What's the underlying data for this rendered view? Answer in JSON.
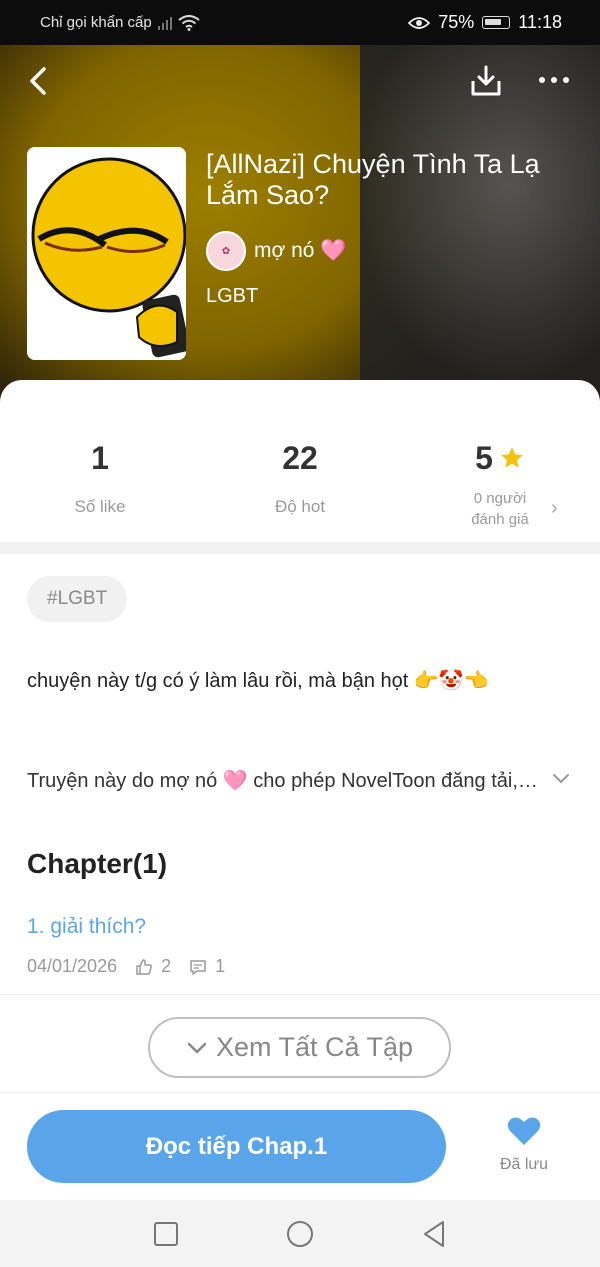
{
  "status_bar": {
    "carrier": "Chỉ gọi khẩn cấp",
    "battery": "75%",
    "time": "11:18"
  },
  "header": {
    "title": "[AllNazi] Chuyện Tình Ta Lạ Lắm Sao?",
    "author": "mợ nó 🩷",
    "genre": "LGBT"
  },
  "stats": {
    "likes": {
      "value": "1",
      "label": "Số like"
    },
    "hot": {
      "value": "22",
      "label": "Độ hot"
    },
    "rating": {
      "value": "5",
      "label_line1": "0 người",
      "label_line2": "đánh giá"
    }
  },
  "tag": "#LGBT",
  "description": "chuyện này t/g có ý làm lâu rồi, mà bận họt 👉🤡👈",
  "permission": "Truyện này do mợ nó 🩷 cho phép NovelToon đăng tải, nội dung chỉ mang tính chất giải trí",
  "chapters": {
    "heading": "Chapter(1)",
    "items": [
      {
        "title": "1. giải thích?",
        "date": "04/01/2026",
        "likes": "2",
        "comments": "1"
      }
    ]
  },
  "see_all_label": "Xem Tất Cả Tập",
  "read_button": "Đọc tiếp Chap.1",
  "saved_label": "Đã lưu",
  "colors": {
    "accent": "#5aa5ea",
    "star": "#f4c20d",
    "link": "#5ba6e6"
  }
}
